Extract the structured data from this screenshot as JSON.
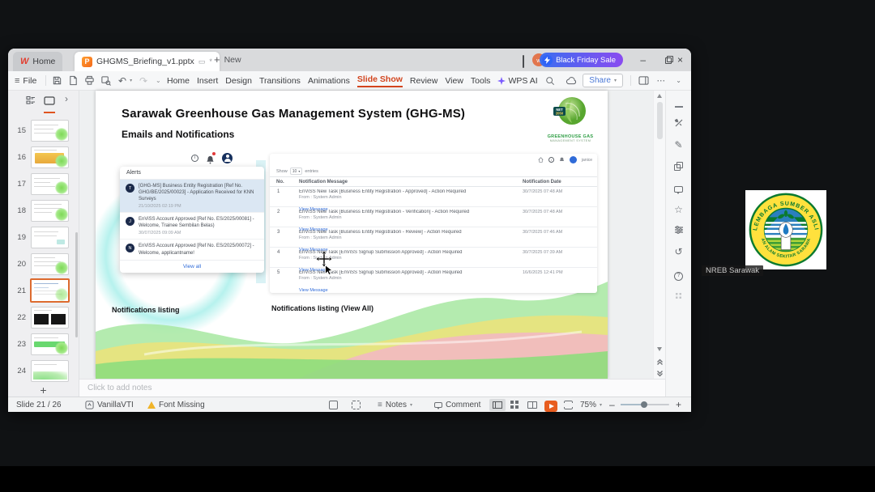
{
  "app": {
    "tabs": {
      "home": "Home",
      "document": "GHGMS_Briefing_v1.pptx",
      "unsaved_indicator": "*",
      "new_label": "New"
    },
    "titlebar": {
      "promo": "Black Friday Sale",
      "avatar_initial": "w"
    },
    "toolbar": {
      "file": "File",
      "share": "Share",
      "wps_ai": "WPS AI"
    },
    "menus": [
      "Home",
      "Insert",
      "Design",
      "Transitions",
      "Animations",
      "Slide Show",
      "Review",
      "View",
      "Tools"
    ]
  },
  "sidebar": {
    "slides": [
      {
        "num": "15"
      },
      {
        "num": "16"
      },
      {
        "num": "17"
      },
      {
        "num": "18"
      },
      {
        "num": "19"
      },
      {
        "num": "20"
      },
      {
        "num": "21"
      },
      {
        "num": "22"
      },
      {
        "num": "23"
      },
      {
        "num": "24"
      }
    ],
    "add_label": "+"
  },
  "slide": {
    "title": "Sarawak Greenhouse Gas Management System (GHG-MS)",
    "subtitle": "Emails and Notifications",
    "logo": {
      "badge_line1": "NET",
      "badge_line2": "2050",
      "name_line1": "GREENHOUSE GAS",
      "name_line2": "MANAGEMENT SYSTEM"
    },
    "alerts": {
      "header": "Alerts",
      "items": [
        {
          "initial": "T",
          "text": "[GHG-MS] Business Entity Registration [Ref No. GHG/BE/2025/00023] - Application Received for KNN Surveys",
          "date": "21/10/2025 02:19 PM"
        },
        {
          "initial": "J",
          "text": "EnViSS Account Approved [Ref No. ES/2025/00081] - Welcome, Trainee Sembilan Belas)",
          "date": "30/07/2025 09:09 AM"
        },
        {
          "initial": "N",
          "text": "EnViSS Account Approved [Ref No. ES/2025/00072] - Welcome, applicantname!",
          "date": ""
        }
      ],
      "view_all": "View all"
    },
    "portal": {
      "user": "janice",
      "show_label": "Show",
      "show_value": "10",
      "entries_label": "entries",
      "columns": {
        "no": "No.",
        "message": "Notification Message",
        "date": "Notification Date"
      },
      "rows": [
        {
          "no": "1",
          "message": "EnViSS New Task [Business Entity Registration - Approved] - Action Required",
          "from": "From : System Admin",
          "link": "View Message",
          "date": "30/7/2025 07:48 AM"
        },
        {
          "no": "2",
          "message": "EnViSS New Task [Business Entity Registration - Verification] - Action Required",
          "from": "From : System Admin",
          "link": "View Message",
          "date": "30/7/2025 07:48 AM"
        },
        {
          "no": "3",
          "message": "EnViSS New Task [Business Entity Registration - Review] - Action Required",
          "from": "From : System Admin",
          "link": "View Message",
          "date": "30/7/2025 07:46 AM"
        },
        {
          "no": "4",
          "message": "EnViSS New Task [EnViSS Signup Submission Approved] - Action Required",
          "from": "From : System Admin",
          "link": "View Message",
          "date": "30/7/2025 07:39 AM"
        },
        {
          "no": "5",
          "message": "EnViSS New Task [EnViSS Signup Submission Approved] - Action Required",
          "from": "From : System Admin",
          "link": "View Message",
          "date": "16/6/2025 12:41 PM"
        }
      ]
    },
    "captions": {
      "left": "Notifications listing",
      "right": "Notifications listing (View All)"
    }
  },
  "notes": {
    "placeholder": "Click to add notes"
  },
  "statusbar": {
    "slide_info": "Slide 21 / 26",
    "theme": "VanillaVTI",
    "font_warning": "Font Missing",
    "notes": "Notes",
    "comment": "Comment",
    "zoom": "75%"
  },
  "participant": {
    "name": "NREB Sarawak",
    "emblem_top": "LEMBAGA SUMBER ASLI",
    "emblem_bottom": "DAN ALAM SEKITAR SARAWAK"
  },
  "colors": {
    "accent_orange": "#d2451e",
    "promo_from": "#3a6ef0",
    "promo_to": "#8a4bf0",
    "link_blue": "#2f6bd8",
    "play_orange": "#e85d1f"
  }
}
